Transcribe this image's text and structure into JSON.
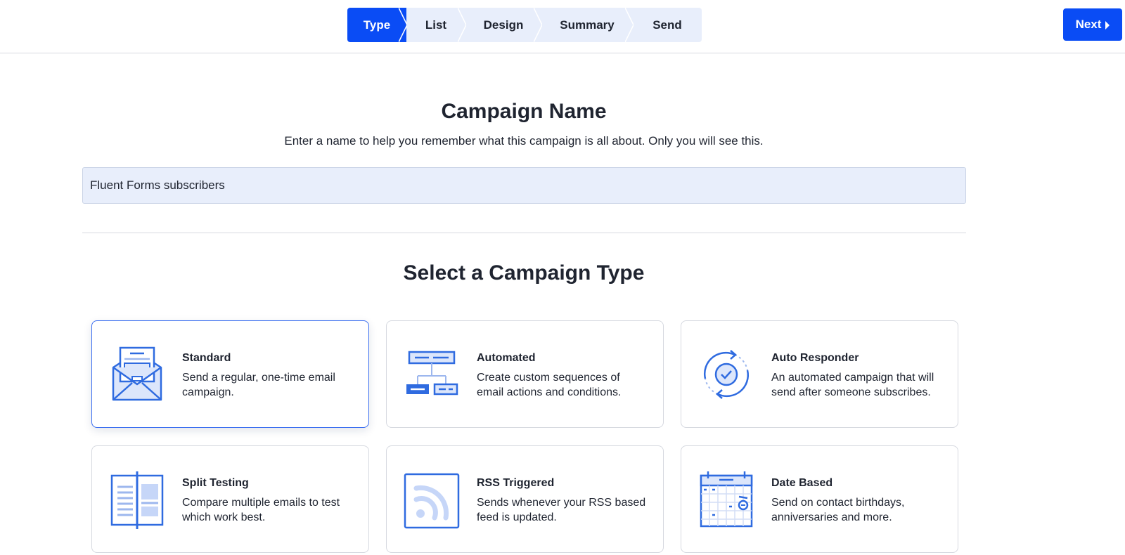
{
  "steps": [
    {
      "label": "Type",
      "active": true
    },
    {
      "label": "List",
      "active": false
    },
    {
      "label": "Design",
      "active": false
    },
    {
      "label": "Summary",
      "active": false
    },
    {
      "label": "Send",
      "active": false
    }
  ],
  "next_button": {
    "label": "Next",
    "icon": "caret-right-icon"
  },
  "campaign_name": {
    "heading": "Campaign Name",
    "description": "Enter a name to help you remember what this campaign is all about. Only you will see this.",
    "value": "Fluent Forms subscribers"
  },
  "campaign_type": {
    "heading": "Select a Campaign Type",
    "cards": [
      {
        "title": "Standard",
        "description": "Send a regular, one-time email campaign.",
        "icon": "envelope-icon",
        "selected": true
      },
      {
        "title": "Automated",
        "description": "Create custom sequences of email actions and conditions.",
        "icon": "flowchart-icon",
        "selected": false
      },
      {
        "title": "Auto Responder",
        "description": "An automated campaign that will send after someone subscribes.",
        "icon": "refresh-check-icon",
        "selected": false
      },
      {
        "title": "Split Testing",
        "description": "Compare multiple emails to test which work best.",
        "icon": "split-page-icon",
        "selected": false
      },
      {
        "title": "RSS Triggered",
        "description": "Sends whenever your RSS based feed is updated.",
        "icon": "rss-icon",
        "selected": false
      },
      {
        "title": "Date Based",
        "description": "Send on contact birthdays, anniversaries and more.",
        "icon": "calendar-icon",
        "selected": false
      }
    ]
  },
  "colors": {
    "accent": "#0a4cf5",
    "icon_blue": "#2f6be0",
    "icon_fill": "#dce6fb",
    "step_bg": "#e8eefb"
  }
}
